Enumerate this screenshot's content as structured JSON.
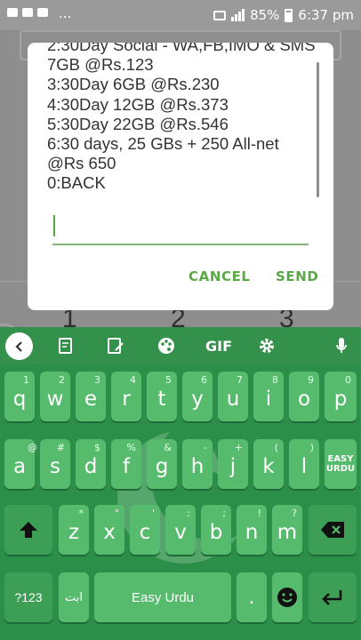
{
  "status_bar": {
    "dots": "...",
    "battery": "85%",
    "time": "6:37 pm"
  },
  "background": {
    "numbers": [
      "1",
      "2",
      "3"
    ]
  },
  "dialog": {
    "message": "2:30Day Social - WA,FB,IMO & SMS\n7GB @Rs.123\n3:30Day 6GB @Rs.230\n4:30Day 12GB @Rs.373\n5:30Day 22GB @Rs.546\n6:30 days, 25 GBs + 250 All-net\n@Rs 650\n0:BACK",
    "input_value": "",
    "cancel": "CANCEL",
    "send": "SEND"
  },
  "keyboard": {
    "toolbar": {
      "gif": "GIF"
    },
    "row1": [
      {
        "k": "q",
        "s": "1"
      },
      {
        "k": "w",
        "s": "2"
      },
      {
        "k": "e",
        "s": "3"
      },
      {
        "k": "r",
        "s": "4"
      },
      {
        "k": "t",
        "s": "5"
      },
      {
        "k": "y",
        "s": "6"
      },
      {
        "k": "u",
        "s": "7"
      },
      {
        "k": "i",
        "s": "8"
      },
      {
        "k": "o",
        "s": "9"
      },
      {
        "k": "p",
        "s": "0"
      }
    ],
    "row2": [
      {
        "k": "a",
        "s": "@"
      },
      {
        "k": "s",
        "s": "#"
      },
      {
        "k": "d",
        "s": "$"
      },
      {
        "k": "f",
        "s": "%"
      },
      {
        "k": "g",
        "s": "&"
      },
      {
        "k": "h",
        "s": "-"
      },
      {
        "k": "j",
        "s": "+"
      },
      {
        "k": "k",
        "s": "("
      },
      {
        "k": "l",
        "s": ")"
      }
    ],
    "easy_urdu_key": "EASY URDU",
    "row3": [
      {
        "k": "z",
        "s": "*"
      },
      {
        "k": "x",
        "s": "\""
      },
      {
        "k": "c",
        "s": "'"
      },
      {
        "k": "v",
        "s": ":"
      },
      {
        "k": "b",
        "s": ";"
      },
      {
        "k": "n",
        "s": "!"
      },
      {
        "k": "m",
        "s": "?"
      }
    ],
    "symbols": "?123",
    "urdu_abc": "ابت",
    "space": "Easy Urdu",
    "period": "."
  },
  "colors": {
    "accent": "#5aa846",
    "keyboard_bg": "#2c8f49",
    "key": "#56bb6c"
  }
}
